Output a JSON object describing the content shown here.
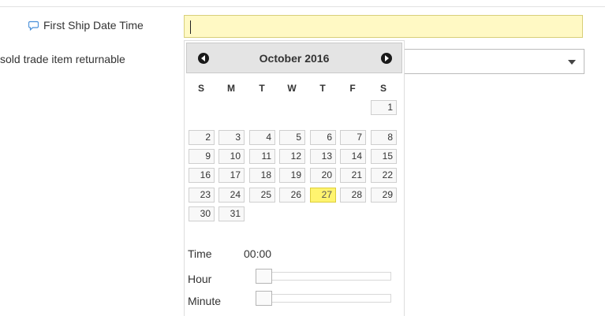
{
  "form": {
    "first_ship_label": "First Ship Date Time",
    "first_ship_value": "",
    "returnable_label": "sold trade item returnable",
    "returnable_value": ""
  },
  "datepicker": {
    "month_year": "October 2016",
    "weekdays": [
      "S",
      "M",
      "T",
      "W",
      "T",
      "F",
      "S"
    ],
    "weeks": [
      [
        "",
        "",
        "",
        "",
        "",
        "",
        "1"
      ],
      [
        "2",
        "3",
        "4",
        "5",
        "6",
        "7",
        "8"
      ],
      [
        "9",
        "10",
        "11",
        "12",
        "13",
        "14",
        "15"
      ],
      [
        "16",
        "17",
        "18",
        "19",
        "20",
        "21",
        "22"
      ],
      [
        "23",
        "24",
        "25",
        "26",
        "27",
        "28",
        "29"
      ],
      [
        "30",
        "31",
        "",
        "",
        "",
        "",
        ""
      ]
    ],
    "highlighted_day": "27",
    "time_label": "Time",
    "time_value": "00:00",
    "hour_label": "Hour",
    "hour_value": 0,
    "minute_label": "Minute",
    "minute_value": 0
  },
  "colors": {
    "input_highlight": "#fff9c4",
    "today_highlight": "#fff46f",
    "label_icon": "#4a90d9"
  },
  "icons": {
    "label_help": "speech-bubble-icon",
    "prev": "chevron-left-circle-icon",
    "next": "chevron-right-circle-icon",
    "select": "caret-down-icon"
  }
}
